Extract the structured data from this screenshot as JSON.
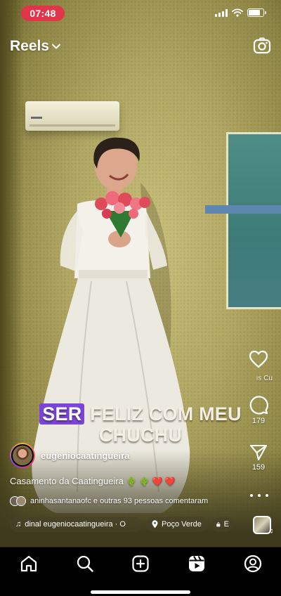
{
  "status_bar": {
    "time": "07:48"
  },
  "header": {
    "title": "Reels"
  },
  "overlay_text": {
    "highlight": "SER",
    "line1_rest": "FELIZ COM MEU",
    "line2": "CHUCHU"
  },
  "actions": {
    "likes_label": " ıs   Cu",
    "comments_count": "179",
    "shares_count": "159"
  },
  "post": {
    "author": "eugeniocaatingueira",
    "caption_text": "Casamento da Caatingueira",
    "caption_emojis": "🌵 🌵 ❤️ ❤️",
    "comments_summary": "aninhasantanaofc e outras 93 pessoas comentaram"
  },
  "chips": {
    "audio": "dinal   eugeniocaatingueira · O",
    "location": "Poço Verde",
    "shop": "E"
  },
  "icons": {
    "camera": "camera-icon",
    "heart": "heart-icon",
    "comment": "comment-icon",
    "share": "send-icon",
    "more": "more-icon",
    "home": "home-icon",
    "search": "search-icon",
    "create": "create-icon",
    "reels": "reels-icon",
    "profile": "profile-icon"
  }
}
